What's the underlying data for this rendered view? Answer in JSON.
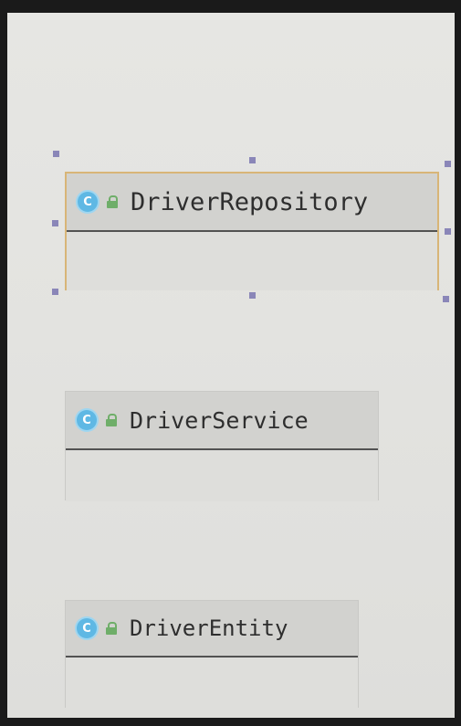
{
  "diagram": {
    "classes": [
      {
        "name": "DriverRepository",
        "icon": "class-icon",
        "icon_letter": "C",
        "visibility_icon": "public-lock-icon",
        "selected": true
      },
      {
        "name": "DriverService",
        "icon": "class-icon",
        "icon_letter": "C",
        "visibility_icon": "public-lock-icon",
        "selected": false
      },
      {
        "name": "DriverEntity",
        "icon": "class-icon",
        "icon_letter": "C",
        "visibility_icon": "public-lock-icon",
        "selected": false
      }
    ],
    "colors": {
      "class_icon": "#5fb8e4",
      "lock_icon": "#6fae69",
      "selection_border": "#d8b577",
      "selection_handle": "#8a86b8",
      "canvas": "#e3e3e0"
    }
  }
}
